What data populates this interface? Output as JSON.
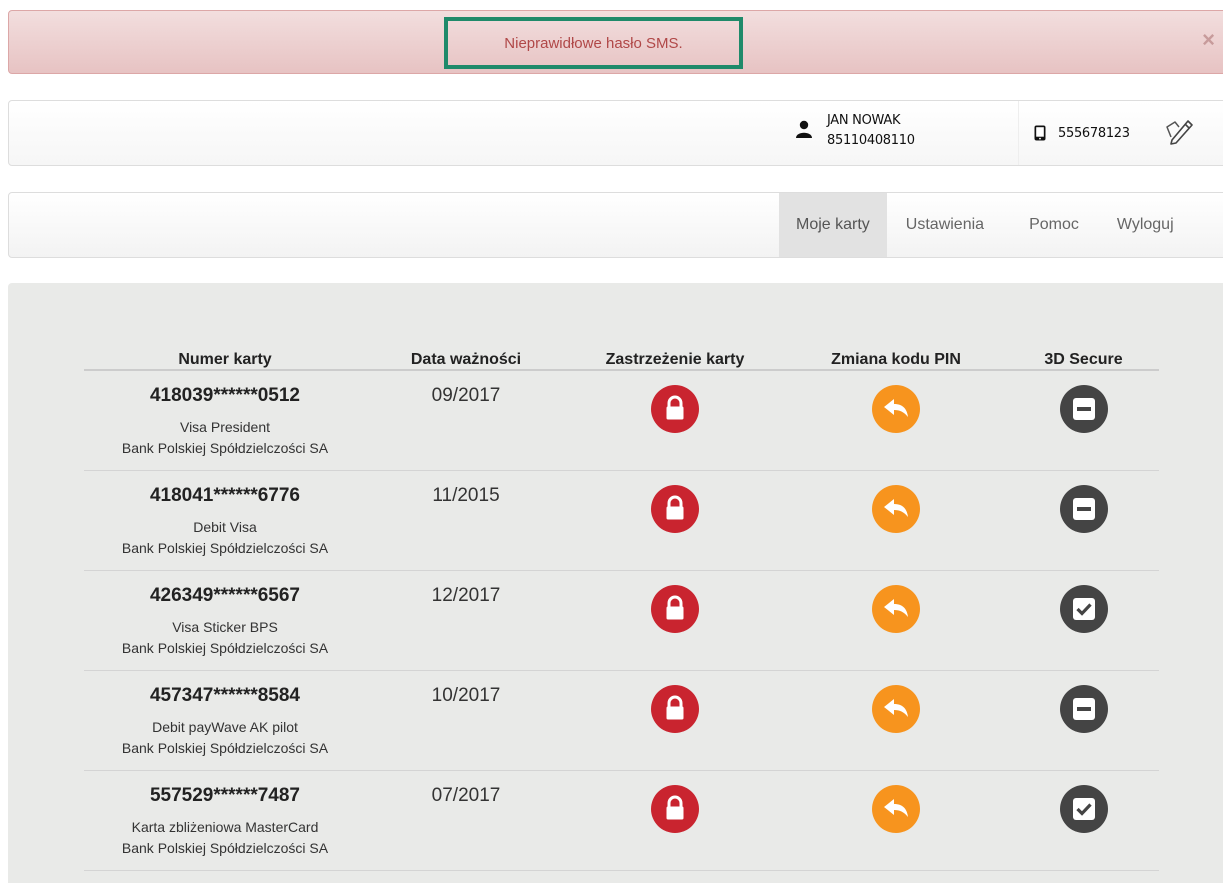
{
  "alert": {
    "message": "Nieprawidłowe hasło SMS.",
    "close": "×"
  },
  "user": {
    "name": "JAN NOWAK",
    "id": "85110408110",
    "phone": "555678123"
  },
  "nav": {
    "items": [
      "Moje karty",
      "Ustawienia",
      "Pomoc",
      "Wyloguj"
    ],
    "active": "Moje karty"
  },
  "table": {
    "headers": [
      "Numer karty",
      "Data ważności",
      "Zastrzeżenie karty",
      "Zmiana kodu PIN",
      "3D Secure"
    ],
    "rows": [
      {
        "number": "418039******0512",
        "name": "Visa President",
        "bank": "Bank Polskiej Spółdzielczości SA",
        "expiry": "09/2017",
        "secure": "minus-icon"
      },
      {
        "number": "418041******6776",
        "name": "Debit Visa",
        "bank": "Bank Polskiej Spółdzielczości SA",
        "expiry": "11/2015",
        "secure": "minus-icon"
      },
      {
        "number": "426349******6567",
        "name": "Visa Sticker BPS",
        "bank": "Bank Polskiej Spółdzielczości SA",
        "expiry": "12/2017",
        "secure": "checkmark-icon"
      },
      {
        "number": "457347******8584",
        "name": "Debit payWave AK pilot",
        "bank": "Bank Polskiej Spółdzielczości SA",
        "expiry": "10/2017",
        "secure": "minus-icon"
      },
      {
        "number": "557529******7487",
        "name": "Karta zbliżeniowa MasterCard",
        "bank": "Bank Polskiej Spółdzielczości SA",
        "expiry": "07/2017",
        "secure": "checkmark-icon"
      }
    ]
  },
  "colors": {
    "alert_bg": "#f2dede",
    "alert_text": "#b04848",
    "highlight": "#1f8a6a",
    "lock": "#c9242f",
    "pin": "#f7941e",
    "secure": "#444444",
    "panel": "#e9eae8"
  }
}
